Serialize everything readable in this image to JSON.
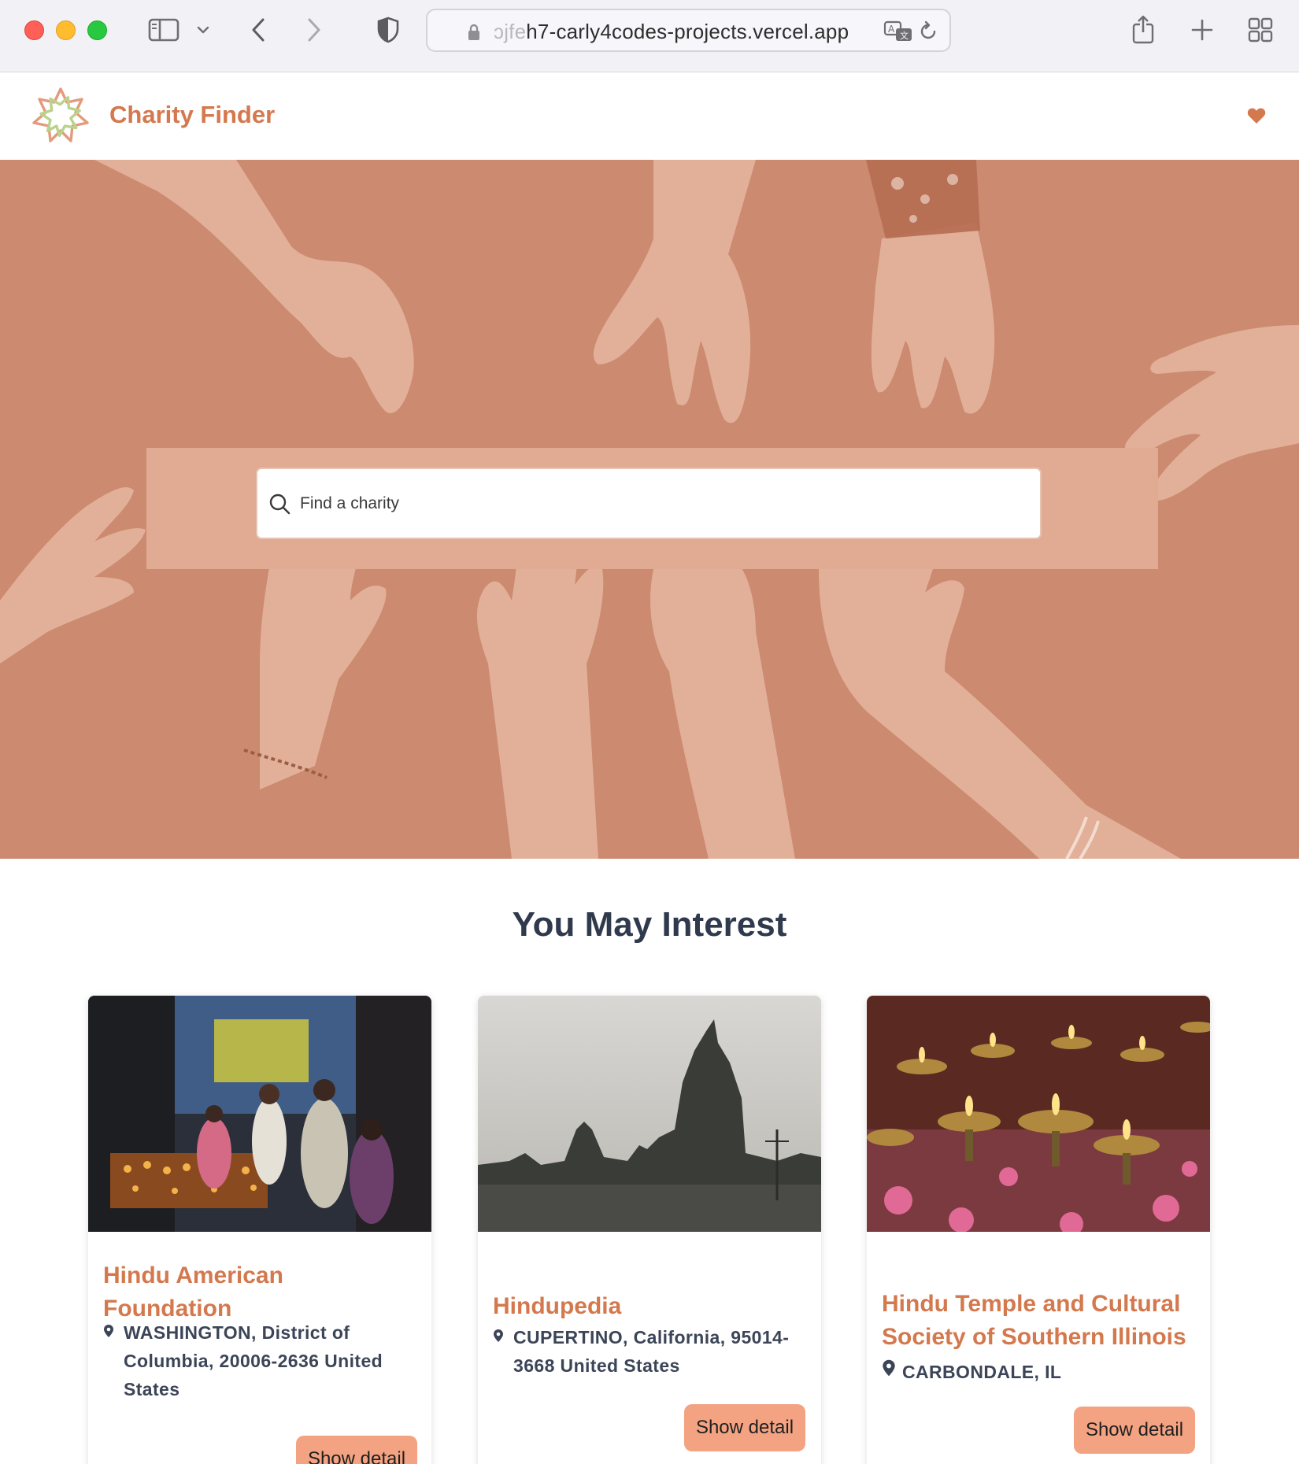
{
  "browser": {
    "url_faded": "ɔjfe",
    "url_main": "h7-carly4codes-projects.vercel.app"
  },
  "app": {
    "brand": "Charity Finder",
    "brand_color": "#d4784d"
  },
  "hero": {
    "background_color": "#cc8a70",
    "search_placeholder": "Find a charity"
  },
  "section": {
    "title": "You May Interest"
  },
  "cards": [
    {
      "title": "Hindu American Foundation",
      "location": "WASHINGTON, District of Columbia, 20006-2636 United States",
      "button": "Show detail",
      "image": "temple-diya-offering-photo"
    },
    {
      "title": "Hindupedia",
      "location": "CUPERTINO, California, 95014-3668 United States",
      "button": "Show detail",
      "image": "temple-silhouette-photo"
    },
    {
      "title": "Hindu Temple and Cultural Society of Southern Illinois",
      "location": "CARBONDALE, IL",
      "button": "Show detail",
      "image": "oil-lamps-flowers-photo"
    }
  ],
  "icons": {
    "favorites": "heart-icon",
    "search": "search-icon",
    "location": "map-pin-icon",
    "logo": "flower-star-logo"
  }
}
